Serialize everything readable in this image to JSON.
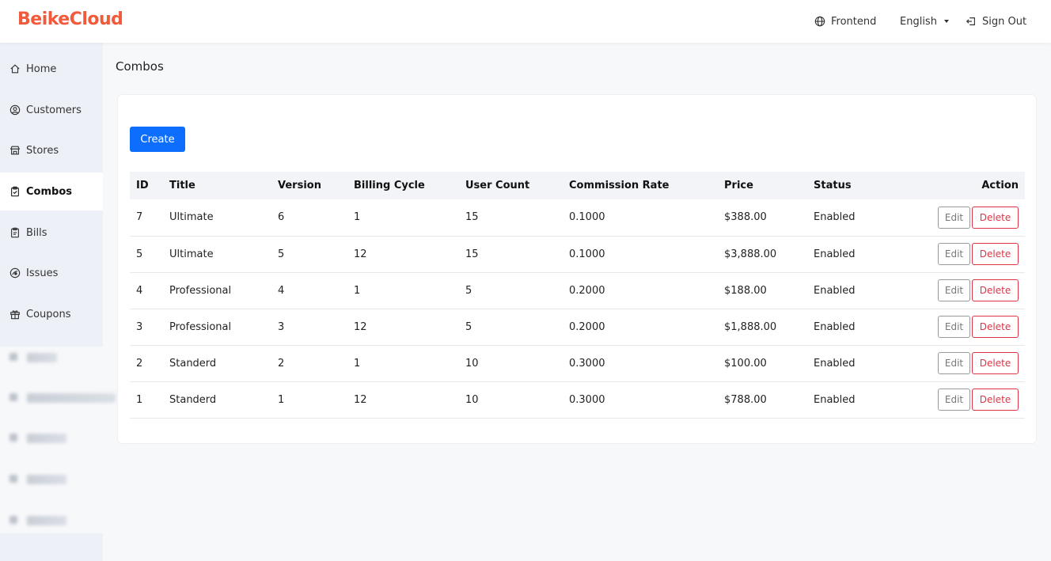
{
  "header": {
    "logo": "BeikeCloud",
    "frontend_label": "Frontend",
    "language_label": "English",
    "signout_label": "Sign Out"
  },
  "sidebar": {
    "items": [
      {
        "label": "Home",
        "icon": "home-icon"
      },
      {
        "label": "Customers",
        "icon": "user-circle-icon"
      },
      {
        "label": "Stores",
        "icon": "store-icon"
      },
      {
        "label": "Combos",
        "icon": "clipboard-icon",
        "active": true
      },
      {
        "label": "Bills",
        "icon": "bill-icon"
      },
      {
        "label": "Issues",
        "icon": "issues-icon"
      },
      {
        "label": "Coupons",
        "icon": "gift-icon"
      }
    ]
  },
  "page": {
    "title": "Combos",
    "create_label": "Create"
  },
  "table": {
    "headers": [
      "ID",
      "Title",
      "Version",
      "Billing Cycle",
      "User Count",
      "Commission Rate",
      "Price",
      "Status",
      "Action"
    ],
    "rows": [
      [
        "7",
        "Ultimate",
        "6",
        "1",
        "15",
        "0.1000",
        "$388.00",
        "Enabled"
      ],
      [
        "5",
        "Ultimate",
        "5",
        "12",
        "15",
        "0.1000",
        "$3,888.00",
        "Enabled"
      ],
      [
        "4",
        "Professional",
        "4",
        "1",
        "5",
        "0.2000",
        "$188.00",
        "Enabled"
      ],
      [
        "3",
        "Professional",
        "3",
        "12",
        "5",
        "0.2000",
        "$1,888.00",
        "Enabled"
      ],
      [
        "2",
        "Standerd",
        "2",
        "1",
        "10",
        "0.3000",
        "$100.00",
        "Enabled"
      ],
      [
        "1",
        "Standerd",
        "1",
        "12",
        "10",
        "0.3000",
        "$788.00",
        "Enabled"
      ]
    ],
    "edit_label": "Edit",
    "delete_label": "Delete"
  },
  "colors": {
    "brand": "#f25a3c",
    "primary": "#0d6efd",
    "danger": "#dc3545"
  }
}
